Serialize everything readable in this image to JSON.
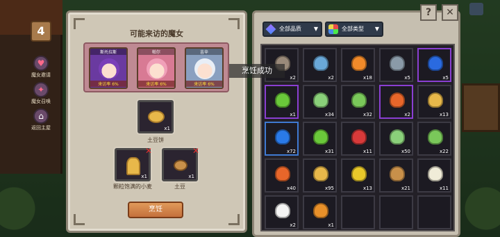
{
  "hud": {
    "level": "4",
    "buttons": [
      {
        "label": "魔女邀请",
        "icon": "heart-icon"
      },
      {
        "label": "魔女召唤",
        "icon": "summon-icon"
      },
      {
        "label": "返回主屋",
        "icon": "home-icon"
      }
    ]
  },
  "left_panel": {
    "title": "可能来访的魔女",
    "witches": [
      {
        "name": "斯托拉斯",
        "rate": "来访率 6%",
        "hair": "#7a3fb8",
        "bg": "#6a3aa0"
      },
      {
        "name": "帕尔",
        "rate": "来访率 6%",
        "hair": "#f0a0b8",
        "bg": "#d87a94"
      },
      {
        "name": "吉辛",
        "rate": "来访率 6%",
        "hair": "#e8eef6",
        "bg": "#8aa0c0"
      }
    ],
    "result": {
      "name": "土豆饼",
      "qty": "x1"
    },
    "ingredients": [
      {
        "name": "颗粒饱满的小麦",
        "qty": "x1"
      },
      {
        "name": "土豆",
        "qty": "x1"
      }
    ],
    "cook_label": "烹饪"
  },
  "toast": "烹饪成功",
  "right_panel": {
    "filter_quality": "全部品质",
    "filter_type": "全部类型",
    "items": [
      {
        "qty": "x2",
        "color": "#9a8a7a",
        "rarity": "common"
      },
      {
        "qty": "x2",
        "color": "#6aa8d8",
        "rarity": "common"
      },
      {
        "qty": "x18",
        "color": "#f08a2a",
        "rarity": "common"
      },
      {
        "qty": "x5",
        "color": "#8a9aa8",
        "rarity": "common"
      },
      {
        "qty": "x5",
        "color": "#2a6ae0",
        "rarity": "rare"
      },
      {
        "qty": "x1",
        "color": "#6ac83a",
        "rarity": "rare"
      },
      {
        "qty": "x34",
        "color": "#8ad07a",
        "rarity": "common"
      },
      {
        "qty": "x32",
        "color": "#7ac85a",
        "rarity": "common"
      },
      {
        "qty": "x2",
        "color": "#e8662a",
        "rarity": "rare"
      },
      {
        "qty": "x13",
        "color": "#e8b84a",
        "rarity": "common"
      },
      {
        "qty": "x72",
        "color": "#2a7ae8",
        "rarity": "uncommon"
      },
      {
        "qty": "x31",
        "color": "#6ac83a",
        "rarity": "common"
      },
      {
        "qty": "x11",
        "color": "#d83a3a",
        "rarity": "common"
      },
      {
        "qty": "x50",
        "color": "#8ad07a",
        "rarity": "common"
      },
      {
        "qty": "x22",
        "color": "#7ac85a",
        "rarity": "common"
      },
      {
        "qty": "x40",
        "color": "#e8662a",
        "rarity": "common"
      },
      {
        "qty": "x95",
        "color": "#e8b84a",
        "rarity": "common"
      },
      {
        "qty": "x13",
        "color": "#e8c82a",
        "rarity": "common"
      },
      {
        "qty": "x21",
        "color": "#c8904a",
        "rarity": "common"
      },
      {
        "qty": "x11",
        "color": "#f0ecd8",
        "rarity": "common"
      },
      {
        "qty": "x2",
        "color": "#f4f4f4",
        "rarity": "common"
      },
      {
        "qty": "x1",
        "color": "#e8902a",
        "rarity": "common"
      },
      {
        "qty": "",
        "color": "",
        "rarity": "empty"
      },
      {
        "qty": "",
        "color": "",
        "rarity": "empty"
      },
      {
        "qty": "",
        "color": "",
        "rarity": "empty"
      }
    ]
  },
  "top_buttons": {
    "help": "?",
    "close": "✕"
  }
}
